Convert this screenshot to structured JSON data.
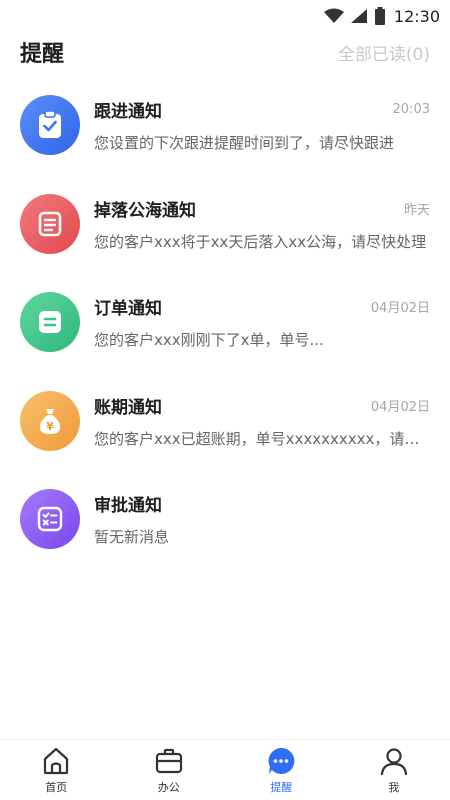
{
  "status": {
    "time": "12:30"
  },
  "header": {
    "title": "提醒",
    "mark_all": "全部已读(0)"
  },
  "notifications": [
    {
      "title": "跟进通知",
      "time": "20:03",
      "message": "您设置的下次跟进提醒时间到了，请尽快跟进",
      "color": "#3b73f0",
      "icon": "clipboard-check-icon"
    },
    {
      "title": "掉落公海通知",
      "time": "昨天",
      "message": "您的客户xxx将于xx天后落入xx公海，请尽快处理",
      "color": "#ea5a5e",
      "icon": "list-doc-icon"
    },
    {
      "title": "订单通知",
      "time": "04月02日",
      "message": "您的客户xxx刚刚下了x单，单号...",
      "color": "#3dc489",
      "icon": "order-doc-icon"
    },
    {
      "title": "账期通知",
      "time": "04月02日",
      "message": "您的客户xxx已超账期，单号xxxxxxxxxx，请尽快处理",
      "color": "#f3a94b",
      "icon": "money-bag-icon"
    },
    {
      "title": "审批通知",
      "time": "",
      "message": "暂无新消息",
      "color": "#8a5af2",
      "icon": "approval-icon"
    }
  ],
  "tabs": [
    {
      "label": "首页",
      "icon": "home-icon"
    },
    {
      "label": "办公",
      "icon": "briefcase-icon"
    },
    {
      "label": "提醒",
      "icon": "chat-bubble-icon",
      "active": true
    },
    {
      "label": "我",
      "icon": "user-icon"
    }
  ],
  "colors": {
    "accent": "#2f6df5"
  }
}
